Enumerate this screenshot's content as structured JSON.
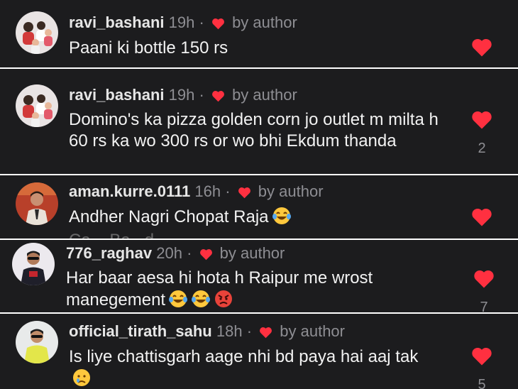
{
  "comments": [
    {
      "username": "ravi_bashani",
      "time": "19h",
      "separator": "·",
      "badge": "by author",
      "text": "Paani ki bottle 150 rs",
      "likes": ""
    },
    {
      "username": "ravi_bashani",
      "time": "19h",
      "separator": "·",
      "badge": "by author",
      "text": "Domino's ka pizza golden corn jo outlet m milta h 60 rs ka wo 300 rs  or wo bhi Ekdum thanda",
      "likes": "2"
    },
    {
      "username": "aman.kurre.0111",
      "time": "16h",
      "separator": "·",
      "badge": "by author",
      "text": "Andher Nagri Chopat Raja",
      "likes": ""
    },
    {
      "username": "776_raghav",
      "time": "20h",
      "separator": "·",
      "badge": "by author",
      "text": "Har baar aesa hi hota h Raipur me wrost manegement",
      "likes": "7"
    },
    {
      "username": "official_tirath_sahu",
      "time": "18h",
      "separator": "·",
      "badge": "by author",
      "text": "Is liye chattisgarh aage nhi bd paya hai aaj tak",
      "likes": "5"
    }
  ],
  "colors": {
    "background": "#1c1c1e",
    "heart": "#ff3040",
    "divider": "#ffffff",
    "muted": "#8e8e93"
  },
  "icons": {
    "liked": "heart-icon",
    "author_like": "small-heart-icon",
    "laughing": "tears-of-joy-emoji",
    "angry": "angry-face-emoji",
    "crying": "crying-face-emoji"
  }
}
